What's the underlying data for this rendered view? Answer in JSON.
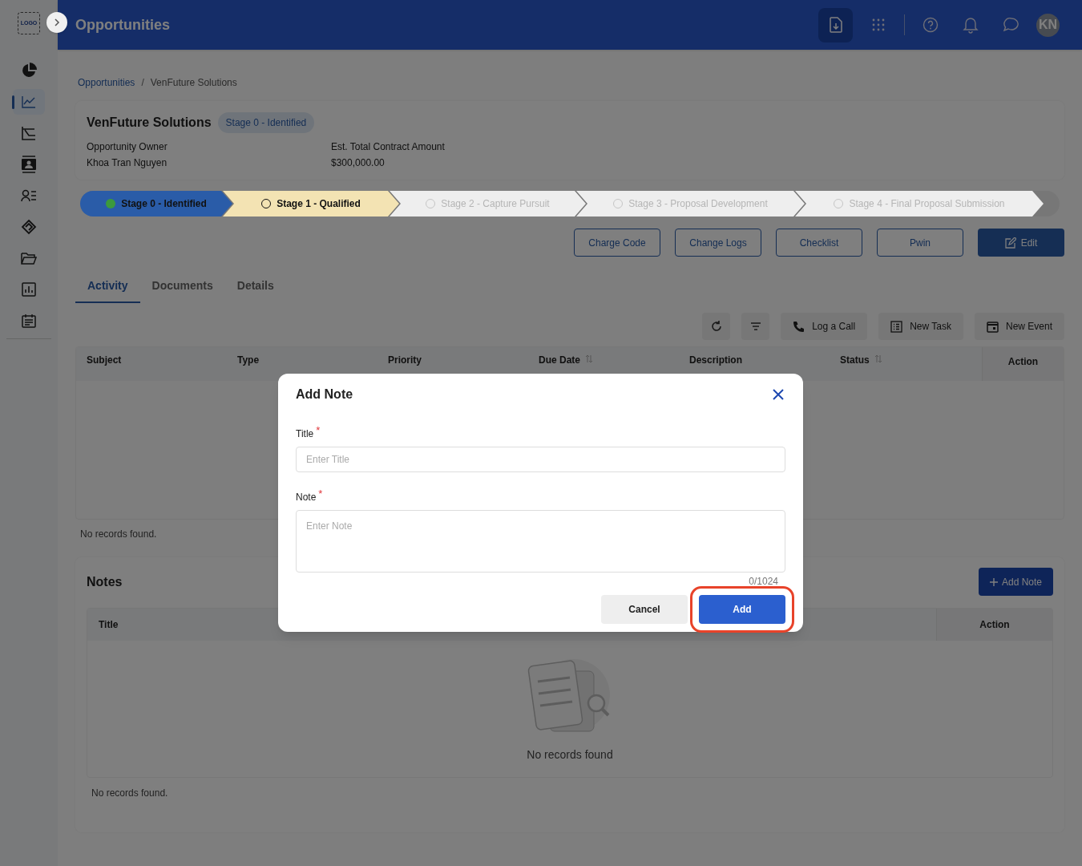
{
  "app": {
    "logo": "LOGO",
    "title": "Opportunities",
    "avatar": "KN"
  },
  "sidebar": {
    "items": [
      {
        "selected": false
      },
      {
        "selected": true
      },
      {
        "selected": false
      },
      {
        "selected": false
      },
      {
        "selected": false
      },
      {
        "selected": false
      },
      {
        "selected": false
      },
      {
        "selected": false
      },
      {
        "selected": false
      }
    ]
  },
  "breadcrumb": {
    "separator": "/",
    "items": [
      "Opportunities",
      "VenFuture Solutions"
    ]
  },
  "opportunity": {
    "name": "VenFuture Solutions",
    "stage_badge": "Stage 0 - Identified",
    "fields": [
      {
        "label": "Opportunity Owner",
        "value": "Khoa Tran Nguyen"
      },
      {
        "label": "Est. Total Contract Amount",
        "value": "$300,000.00"
      }
    ]
  },
  "stages": [
    {
      "label": "Stage 0 - Identified",
      "completed": true,
      "selected": false
    },
    {
      "label": "Stage 1 - Qualified",
      "completed": false,
      "selected": true
    },
    {
      "label": "Stage 2 - Capture Pursuit",
      "completed": false,
      "selected": false
    },
    {
      "label": "Stage 3 - Proposal Development",
      "completed": false,
      "selected": false
    },
    {
      "label": "Stage 4 - Final Proposal Submission",
      "completed": false,
      "selected": false
    }
  ],
  "actions": [
    {
      "label": "Charge Code",
      "kind": "outline"
    },
    {
      "label": "Change Logs",
      "kind": "outline"
    },
    {
      "label": "Checklist",
      "kind": "outline"
    },
    {
      "label": "Pwin",
      "kind": "outline"
    },
    {
      "label": "Edit",
      "kind": "primary"
    }
  ],
  "tabs": [
    {
      "label": "Activity",
      "selected": true
    },
    {
      "label": "Documents",
      "selected": false
    },
    {
      "label": "Details",
      "selected": false
    }
  ],
  "activity_toolbar": [
    {
      "kind": "refresh"
    },
    {
      "kind": "filter"
    },
    {
      "kind": "call",
      "label": "Log a Call"
    },
    {
      "kind": "task",
      "label": "New Task"
    },
    {
      "kind": "event",
      "label": "New Event"
    }
  ],
  "activity_table": {
    "columns": [
      {
        "label": "Subject",
        "kind": "plain"
      },
      {
        "label": "Type",
        "kind": "plain"
      },
      {
        "label": "Priority",
        "kind": "plain"
      },
      {
        "label": "Due Date",
        "kind": "sortable"
      },
      {
        "label": "Description",
        "kind": "plain"
      },
      {
        "label": "Status",
        "kind": "sortable"
      }
    ],
    "action_column": "Action",
    "empty_text": "No records found."
  },
  "notes": {
    "title": "Notes",
    "add_button": "Add Note",
    "columns": [
      "Title"
    ],
    "action_column": "Action",
    "empty_title": "No records found",
    "footer": "No records found."
  },
  "modal": {
    "title": "Add Note",
    "fields": [
      {
        "kind": "input",
        "label": "Title",
        "required_mark": "*",
        "placeholder": "Enter Title"
      },
      {
        "kind": "textarea",
        "label": "Note",
        "required_mark": "*",
        "placeholder": "Enter Note",
        "counter": "0/1024"
      }
    ],
    "buttons": [
      {
        "label": "Cancel",
        "kind": "secondary",
        "highlighted": false
      },
      {
        "label": "Add",
        "kind": "primary",
        "highlighted": true
      }
    ]
  }
}
